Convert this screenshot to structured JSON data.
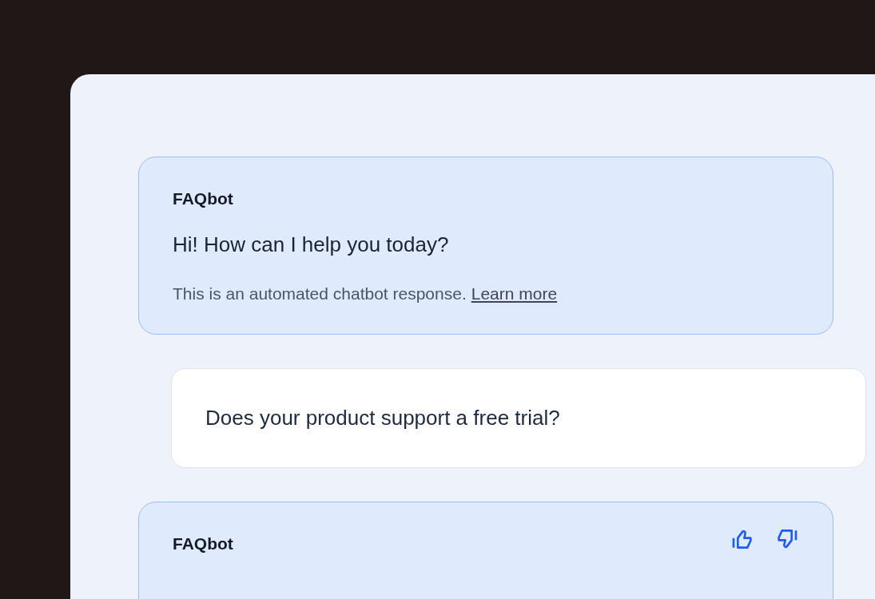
{
  "messages": [
    {
      "kind": "bot",
      "sender": "FAQbot",
      "text": "Hi! How can I help you today?",
      "note": "This is an automated chatbot response.",
      "link": "Learn more",
      "feedback": false
    },
    {
      "kind": "user",
      "text": "Does your product support a free trial?"
    },
    {
      "kind": "bot",
      "sender": "FAQbot",
      "feedback": true
    }
  ]
}
